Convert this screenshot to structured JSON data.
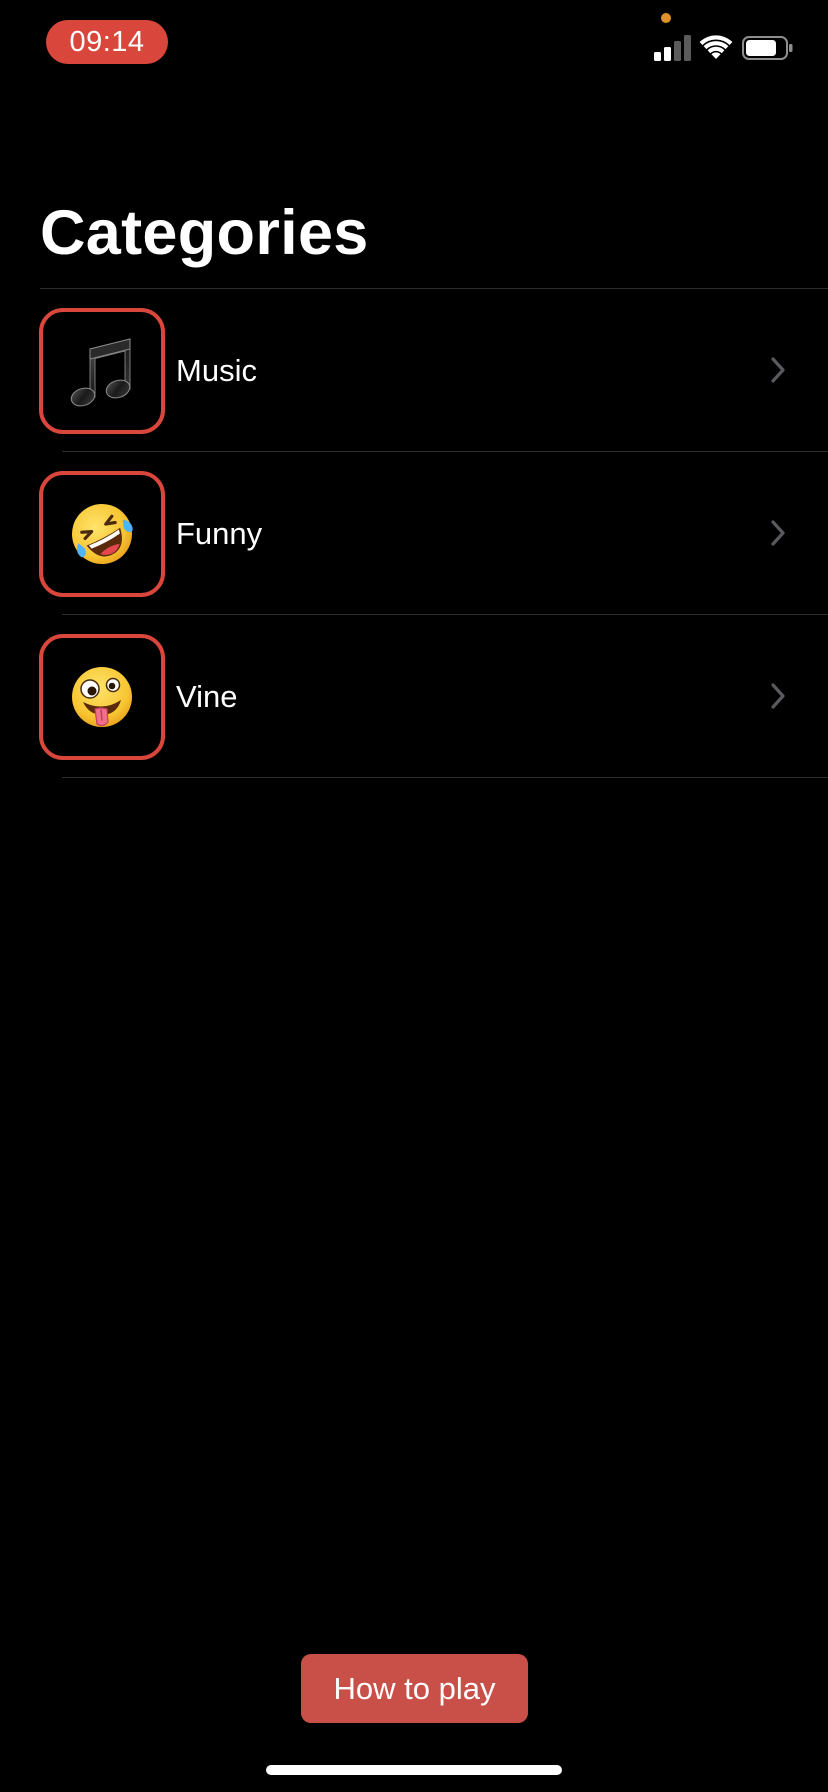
{
  "status_bar": {
    "time": "09:14",
    "icons": [
      "cellular-signal-icon",
      "wifi-icon",
      "battery-icon"
    ],
    "time_pill_color": "#d9473c",
    "privacy_dot_color": "#e0932a"
  },
  "page": {
    "title": "Categories"
  },
  "categories": [
    {
      "label": "Music",
      "icon": "music-note-icon"
    },
    {
      "label": "Funny",
      "icon": "rolling-laughing-emoji-icon"
    },
    {
      "label": "Vine",
      "icon": "zany-face-emoji-icon"
    }
  ],
  "footer": {
    "how_to_play_label": "How to play",
    "button_color": "#c85048"
  },
  "colors": {
    "background": "#000000",
    "accent": "#d9473c",
    "divider": "#2e2e2e",
    "chevron": "#5a5a5e"
  }
}
